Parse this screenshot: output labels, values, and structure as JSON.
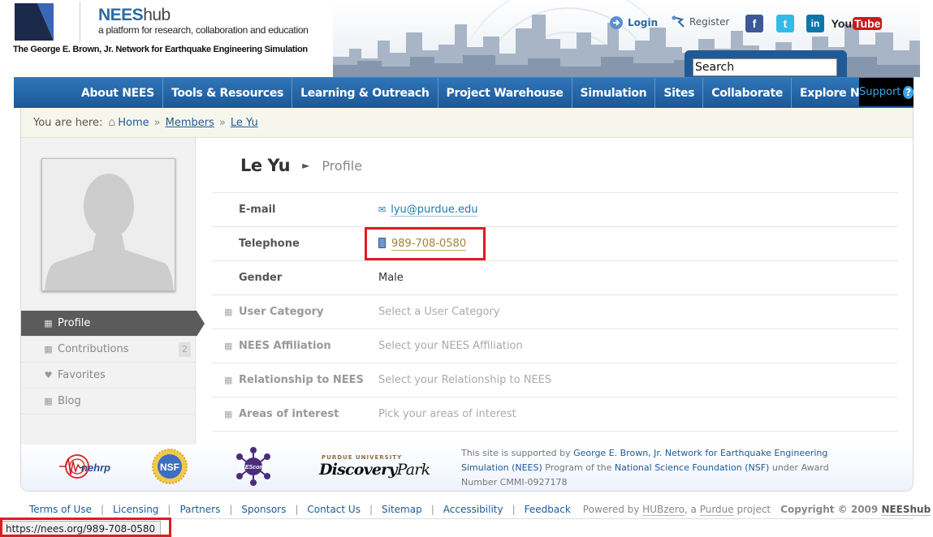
{
  "site": {
    "name_main": "NEES",
    "name_suffix": "hub",
    "tagline": "a platform for research, collaboration and education",
    "network_name": "The George E. Brown, Jr. Network for Earthquake Engineering Simulation"
  },
  "header": {
    "login_label": "Login",
    "register_label": "Register",
    "youtube_you": "You",
    "youtube_tube": "Tube",
    "facebook_glyph": "f",
    "twitter_glyph": "t",
    "linkedin_glyph": "in",
    "search_value": "Search"
  },
  "nav": {
    "items": [
      "About NEES",
      "Tools & Resources",
      "Learning & Outreach",
      "Project Warehouse",
      "Simulation",
      "Sites",
      "Collaborate",
      "Explore NEEShub"
    ],
    "support_label": "Support",
    "help_glyph": "?"
  },
  "breadcrumb": {
    "prefix": "You are here:",
    "home": "Home",
    "members": "Members",
    "current": "Le Yu",
    "separator": "»"
  },
  "sidebar": {
    "items": [
      {
        "label": "Profile",
        "icon": "profile-icon",
        "active": true
      },
      {
        "label": "Contributions",
        "icon": "contributions-icon",
        "count": "2"
      },
      {
        "label": "Favorites",
        "icon": "heart-icon"
      },
      {
        "label": "Blog",
        "icon": "blog-icon"
      }
    ]
  },
  "profile": {
    "name": "Le Yu",
    "arrow": "►",
    "section": "Profile",
    "fields": [
      {
        "label": "E-mail",
        "value": "lyu@purdue.edu"
      },
      {
        "label": "Telephone",
        "value": "989-708-0580"
      },
      {
        "label": "Gender",
        "value": "Male"
      },
      {
        "label": "User Category",
        "value": "Select a User Category"
      },
      {
        "label": "NEES Affiliation",
        "value": "Select your NEES Affiliation"
      },
      {
        "label": "Relationship to NEES",
        "value": "Select your Relationship to NEES"
      },
      {
        "label": "Areas of interest",
        "value": "Pick your areas of interest"
      }
    ]
  },
  "sponsors": {
    "nehrp": "nehrp",
    "nsf": "NSF",
    "neescomm": "NEEScomm",
    "discovery_top": "PURDUE UNIVERSITY",
    "discovery_main": "Discovery",
    "discovery_park": "Park",
    "support_text_1": "This site is supported by ",
    "support_link_1": "George E. Brown, Jr. Network for Earthquake Engineering Simulation (NEES)",
    "support_text_2": " Program of the ",
    "support_link_2": "National Science Foundation (NSF)",
    "support_text_3": " under Award Number CMMI-0927178"
  },
  "footer": {
    "links": [
      "Terms of Use",
      "Licensing",
      "Partners",
      "Sponsors",
      "Contact Us",
      "Sitemap",
      "Accessibility",
      "Feedback"
    ],
    "separator": "|",
    "powered_prefix": "Powered by ",
    "hubzero": "HUBzero",
    "powered_mid": ", a ",
    "purdue": "Purdue",
    "powered_suffix": " project",
    "copyright_prefix": "Copyright © 2009 ",
    "copyright_owner": "NEEShub"
  },
  "status_bar": {
    "url": "https://nees.org/989-708-0580"
  },
  "colors": {
    "nav_blue": "#1f5a96",
    "link_blue": "#1f7aa8",
    "highlight_red": "#e11b22"
  }
}
